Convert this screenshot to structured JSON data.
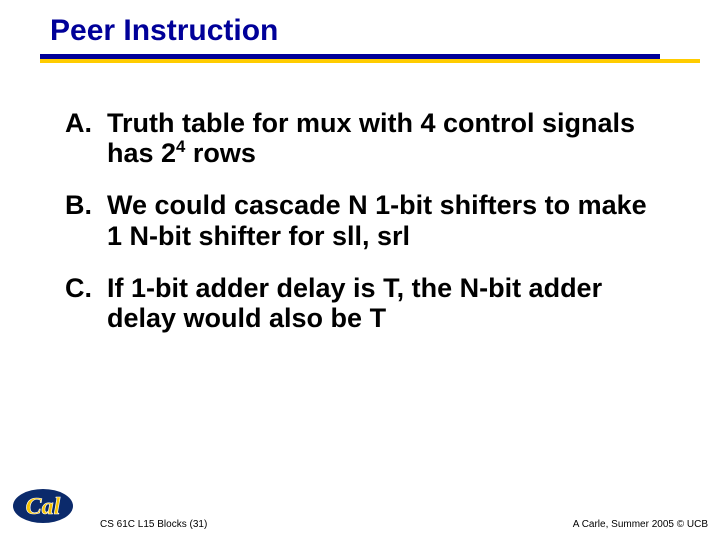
{
  "title": "Peer Instruction",
  "items": [
    {
      "letter": "A.",
      "html": "Truth table for mux with 4 control signals has 2<sup>4</sup> rows"
    },
    {
      "letter": "B.",
      "html": "We could cascade N 1-bit shifters to make 1 N-bit shifter for sll, srl"
    },
    {
      "letter": "C.",
      "html": "If 1-bit adder delay is T, the N-bit adder delay would also be T"
    }
  ],
  "footer": {
    "left": "CS 61C L15 Blocks (31)",
    "right": "A Carle, Summer 2005 © UCB"
  },
  "logo": {
    "alt": "Cal"
  }
}
